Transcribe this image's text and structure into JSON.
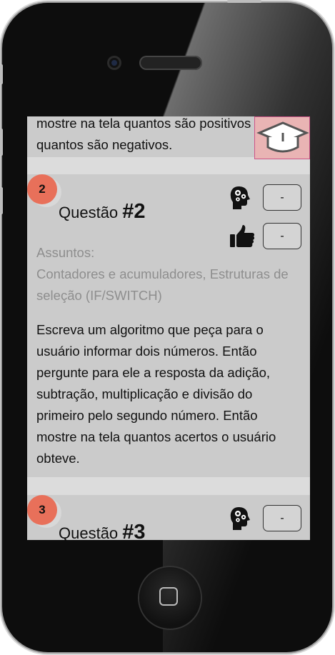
{
  "question1": {
    "text_partial_line": "mostre na tela quantos são positivos e",
    "text_last_line": "quantos são negativos."
  },
  "question2": {
    "number": "2",
    "title_prefix": "Questão",
    "title_number": "#2",
    "difficulty_value": "-",
    "likes_value": "-",
    "subjects_label": "Assuntos:",
    "subjects": "Contadores e acumuladores, Estruturas de seleção (IF/SWITCH)",
    "text": "Escreva um algoritmo que peça para o usuário informar dois números. Então pergunte para ele a resposta da adição, subtração, multiplicação e divisão do primeiro pelo segundo número. Então mostre na tela quantos acertos o usuário obteve."
  },
  "question3": {
    "number": "3",
    "title_prefix": "Questão",
    "title_number": "#3",
    "difficulty_value": "-"
  },
  "colors": {
    "badge": "#e8705a",
    "card": "#cbcbcb",
    "screen_bg": "#dcdcdc"
  },
  "icons": {
    "difficulty": "brain-gears-icon",
    "likes": "thumbs-up-icon",
    "logo": "graduation-cap-logo"
  }
}
